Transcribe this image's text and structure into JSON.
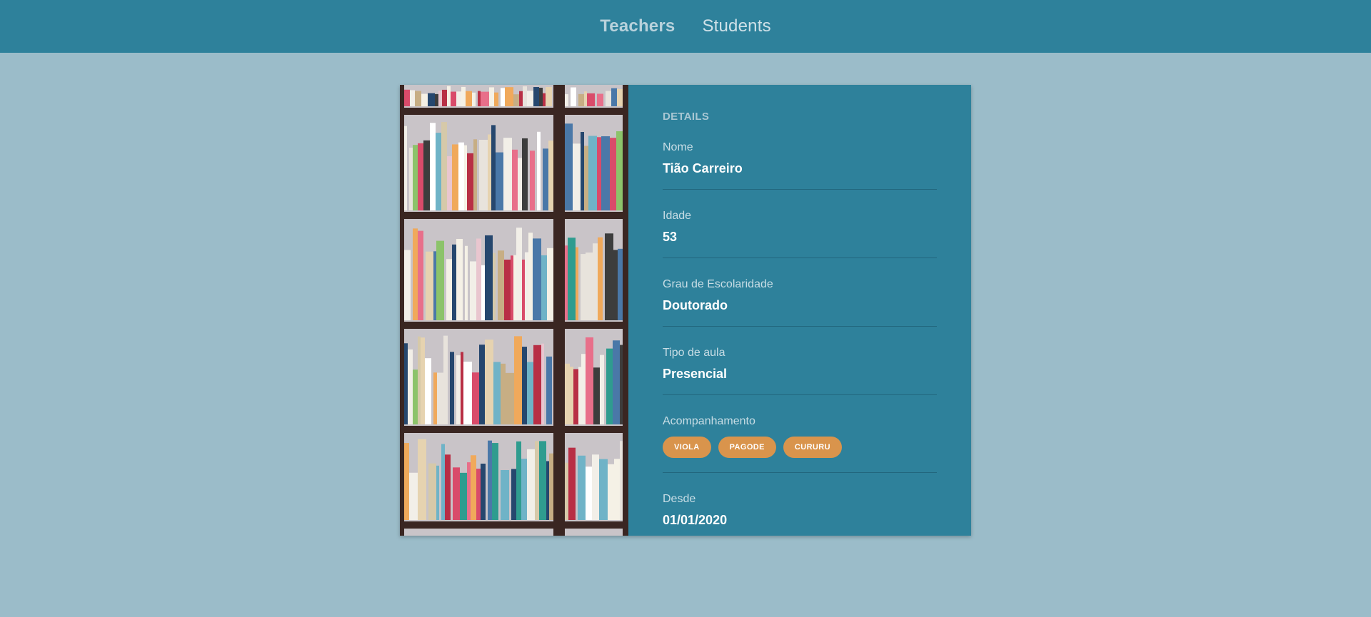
{
  "nav": {
    "teachers_label": "Teachers",
    "students_label": "Students"
  },
  "details": {
    "section_title": "DETAILS",
    "fields": [
      {
        "label": "Nome",
        "value": "Tião Carreiro"
      },
      {
        "label": "Idade",
        "value": "53"
      },
      {
        "label": "Grau de Escolaridade",
        "value": "Doutorado"
      },
      {
        "label": "Tipo de aula",
        "value": "Presencial"
      }
    ],
    "acompanhamento": {
      "label": "Acompanhamento",
      "chips": [
        "VIOLA",
        "PAGODE",
        "CURURU"
      ]
    },
    "desde": {
      "label": "Desde",
      "value": "01/01/2020"
    }
  },
  "colors": {
    "header": "#2e819b",
    "background": "#9bbcc9",
    "card": "#2e819b",
    "chip": "#d9944c"
  },
  "image": {
    "icon": "bookshelf-photo"
  }
}
